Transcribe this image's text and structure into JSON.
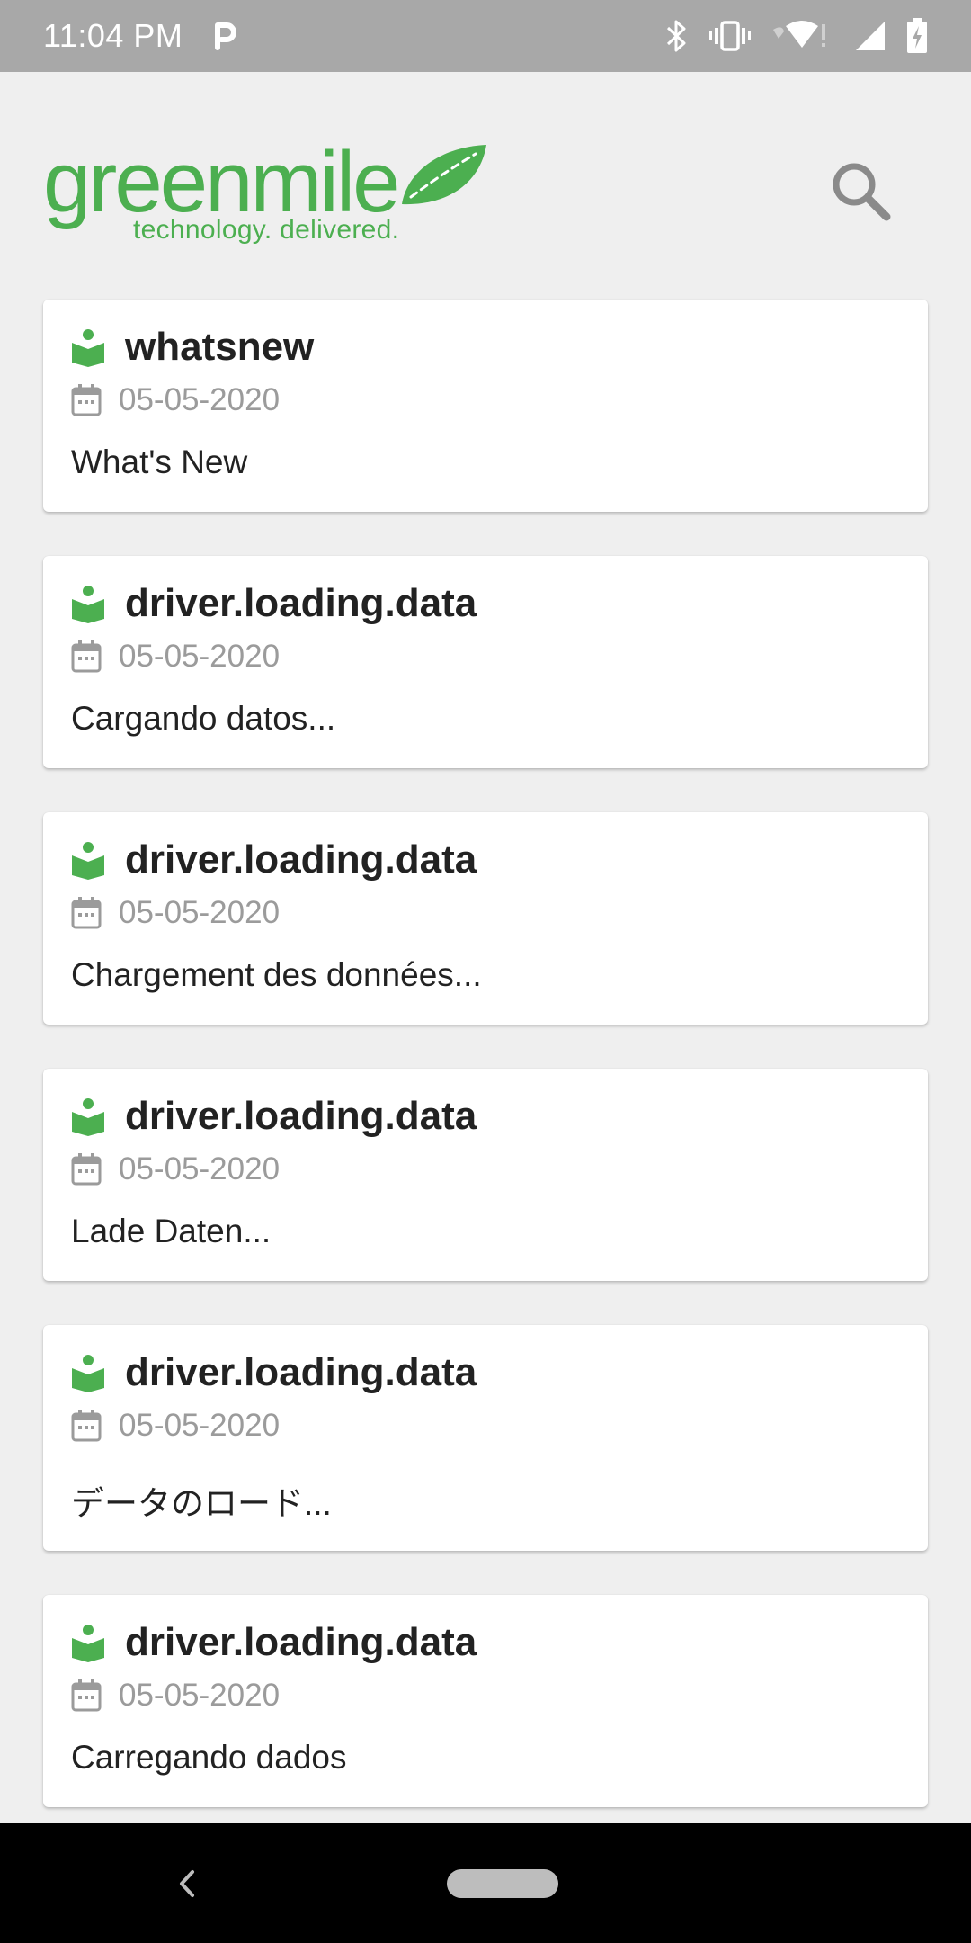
{
  "status_bar": {
    "time": "11:04 PM",
    "icons": [
      "parking-icon",
      "bluetooth-icon",
      "vibrate-icon",
      "wifi-icon",
      "signal-icon",
      "battery-charging-icon"
    ]
  },
  "header": {
    "logo_text": "greenmile",
    "logo_tagline": "technology. delivered.",
    "search_icon": "search-icon"
  },
  "colors": {
    "brand_green": "#4caf50",
    "background": "#efefef",
    "card": "#ffffff",
    "status_bar": "#a8a8a8"
  },
  "items": [
    {
      "key": "whatsnew",
      "date": "05-05-2020",
      "text": "What's New"
    },
    {
      "key": "driver.loading.data",
      "date": "05-05-2020",
      "text": "Cargando datos..."
    },
    {
      "key": "driver.loading.data",
      "date": "05-05-2020",
      "text": "Chargement des données..."
    },
    {
      "key": "driver.loading.data",
      "date": "05-05-2020",
      "text": "Lade Daten..."
    },
    {
      "key": "driver.loading.data",
      "date": "05-05-2020",
      "text": "データのロード..."
    },
    {
      "key": "driver.loading.data",
      "date": "05-05-2020",
      "text": "Carregando dados"
    }
  ],
  "nav_bar": {
    "back_icon": "back-icon",
    "home_icon": "home-pill-icon"
  }
}
